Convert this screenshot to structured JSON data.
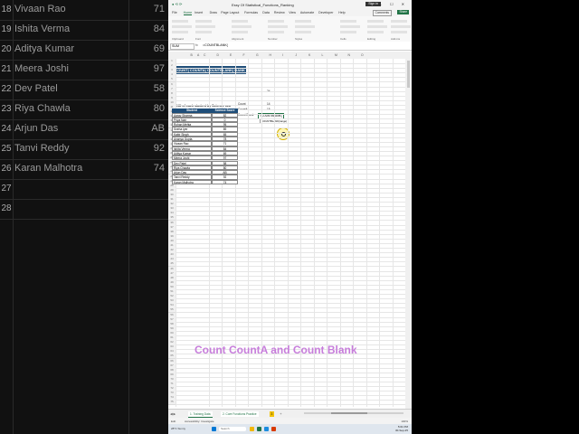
{
  "bg_rows": [
    {
      "num": "18",
      "name": "Vivaan Rao",
      "score": "71"
    },
    {
      "num": "19",
      "name": "Ishita Verma",
      "score": "84"
    },
    {
      "num": "20",
      "name": "Aditya Kumar",
      "score": "69"
    },
    {
      "num": "21",
      "name": "Meera Joshi",
      "score": "97"
    },
    {
      "num": "22",
      "name": "Dev Patel",
      "score": "58"
    },
    {
      "num": "23",
      "name": "Riya Chawla",
      "score": "80"
    },
    {
      "num": "24",
      "name": "Arjun Das",
      "score": "AB"
    },
    {
      "num": "25",
      "name": "Tanvi Reddy",
      "score": "92"
    },
    {
      "num": "26",
      "name": "Karan Malhotra",
      "score": "74"
    },
    {
      "num": "27",
      "name": "",
      "score": ""
    },
    {
      "num": "28",
      "name": "",
      "score": ""
    }
  ],
  "window": {
    "title": "Essy Of Statistical_Functions_Ranking",
    "signin": "Sign in",
    "controls": "— ☐ ✕"
  },
  "menu": {
    "tabs": [
      "File",
      "Home",
      "Insert",
      "Draw",
      "Page Layout",
      "Formulas",
      "Data",
      "Review",
      "View",
      "Automate",
      "Developer",
      "Help"
    ],
    "active": "Home",
    "comments": "Comments",
    "share": "Share"
  },
  "ribbon": {
    "groups": [
      "Clipboard",
      "Font",
      "Alignment",
      "Number",
      "Styles",
      "Cells",
      "Editing",
      "Add-ins"
    ]
  },
  "formula_bar": {
    "name_box": "SUM",
    "fx": "fx",
    "formula": "=COUNTBLANK("
  },
  "columns": [
    "A",
    "B",
    "C",
    "D",
    "E",
    "F",
    "G",
    "H",
    "I",
    "J",
    "K",
    "L",
    "M",
    "N",
    "O"
  ],
  "sheet": {
    "title": "| COUNT| COUNTA| COUNTBLANK| RANK",
    "subtitle": "RANK of each student by Science sco",
    "headers": [
      "Student",
      "Science Score"
    ],
    "rows": [
      {
        "name": "Aarav Sharma",
        "score": "82"
      },
      {
        "name": "Priya Nair",
        "score": "0"
      },
      {
        "name": "Rohan Mehta",
        "score": "95"
      },
      {
        "name": "Sneha Iyer",
        "score": "89"
      },
      {
        "name": "Kabir Singh",
        "score": "65"
      },
      {
        "name": "Ananya Gupta",
        "score": "78"
      },
      {
        "name": "Vivaan Rao",
        "score": "71"
      },
      {
        "name": "Ishita Verma",
        "score": "84"
      },
      {
        "name": "Aditya Kumar",
        "score": "69"
      },
      {
        "name": "Meera Joshi",
        "score": "97"
      },
      {
        "name": "Dev Patel",
        "score": "58"
      },
      {
        "name": "Riya Chawla",
        "score": "80"
      },
      {
        "name": "Arjun Das",
        "score": "AB"
      },
      {
        "name": "Tanvi Reddy",
        "score": "92"
      },
      {
        "name": "Karan Malhotra",
        "score": "74"
      }
    ],
    "side": {
      "top_value": "24",
      "count_label": "Count",
      "count_value": "14",
      "counta_label": "CountA",
      "counta_value": "15",
      "countblank_label": "Count Blank",
      "edit_formula": "=COUNTBLANK(",
      "tooltip": "COUNTBLANK(range)"
    }
  },
  "overlay_caption": "Count CountA and Count Blank",
  "sheet_tabs": [
    {
      "label": "1. Training Data",
      "active": true
    },
    {
      "label": "2. Core Functions Practice",
      "active": false
    },
    {
      "label": "3",
      "active": false
    }
  ],
  "status": {
    "ready": "Edit",
    "accessibility": "Accessibility: Investigate",
    "zoom": "100%"
  },
  "taskbar": {
    "weather": "28°C Sunny",
    "search": "Search",
    "time": "5:01 PM",
    "date": "30-Sep-25"
  },
  "colors": {
    "excel_green": "#217346",
    "table_header": "#1f4e79",
    "caption": "#c77ddb"
  }
}
